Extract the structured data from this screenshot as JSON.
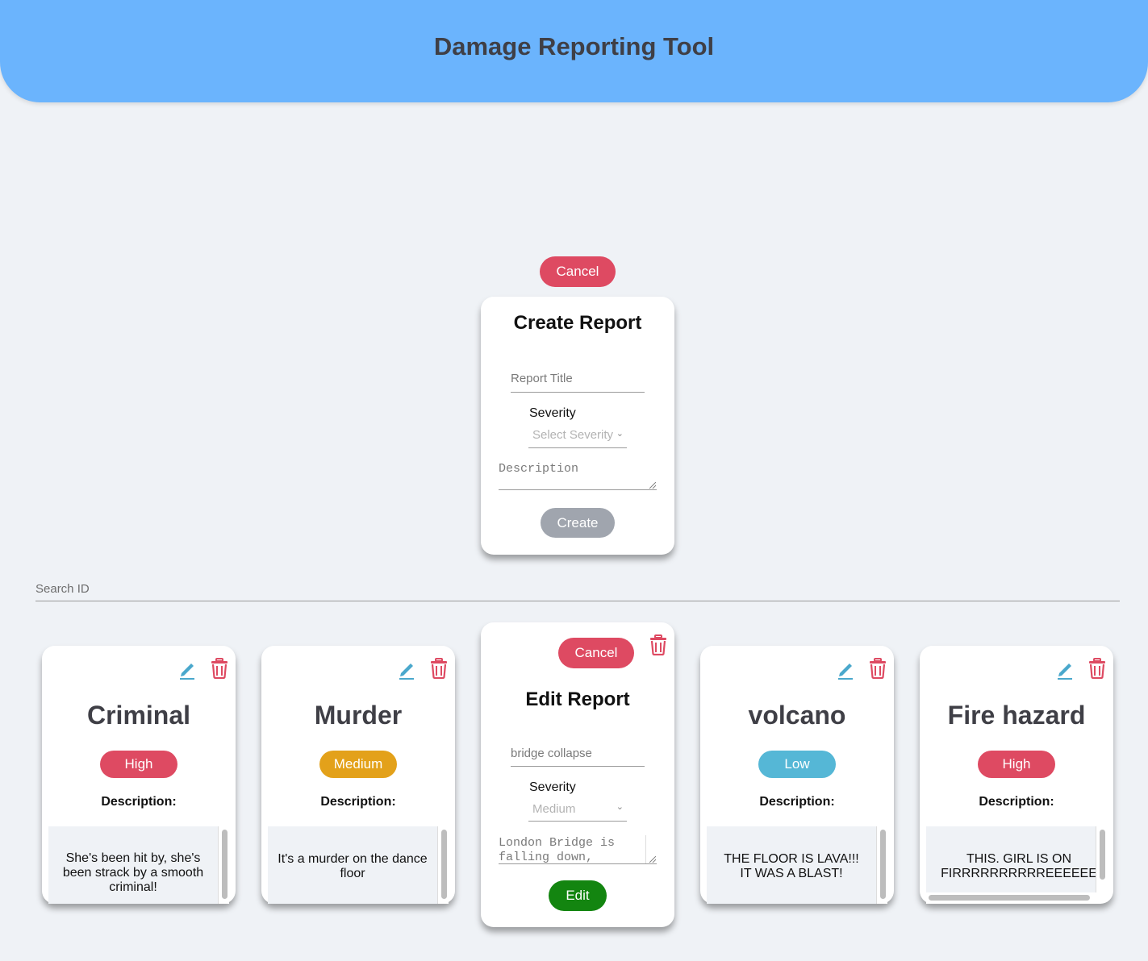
{
  "header": {
    "title": "Damage Reporting Tool",
    "color": "#6bb4fd"
  },
  "create_form": {
    "cancel_label": "Cancel",
    "title": "Create Report",
    "title_placeholder": "Report Title",
    "severity_label": "Severity",
    "severity_placeholder": "Select Severity",
    "description_placeholder": "Description",
    "create_label": "Create"
  },
  "search": {
    "placeholder": "Search ID"
  },
  "reports": [
    {
      "title": "Criminal",
      "severity": "High",
      "severity_color": "#de4a62",
      "description_label": "Description:",
      "description": "She's been hit by, she's been strack by a smooth criminal!",
      "edit_icon": "pencil-icon",
      "delete_icon": "trash-icon"
    },
    {
      "title": "Murder",
      "severity": "Medium",
      "severity_color": "#e3a11a",
      "description_label": "Description:",
      "description": "It's a murder on the dance floor",
      "edit_icon": "pencil-icon",
      "delete_icon": "trash-icon"
    },
    {
      "title": "volcano",
      "severity": "Low",
      "severity_color": "#55b7d6",
      "description_label": "Description:",
      "description": "THE FLOOR IS LAVA!!! IT WAS A BLAST!",
      "edit_icon": "pencil-icon",
      "delete_icon": "trash-icon"
    },
    {
      "title": "Fire hazard",
      "severity": "High",
      "severity_color": "#de4a62",
      "description_label": "Description:",
      "description": "THIS. GIRL IS ON FIRRRRRRRRRREEEEEE",
      "edit_icon": "pencil-icon",
      "delete_icon": "trash-icon"
    }
  ],
  "edit_form": {
    "cancel_label": "Cancel",
    "title": "Edit Report",
    "title_value": "bridge collapse",
    "severity_label": "Severity",
    "severity_value": "Medium",
    "description_value": "London Bridge is falling down,",
    "edit_label": "Edit",
    "delete_icon": "trash-icon"
  }
}
